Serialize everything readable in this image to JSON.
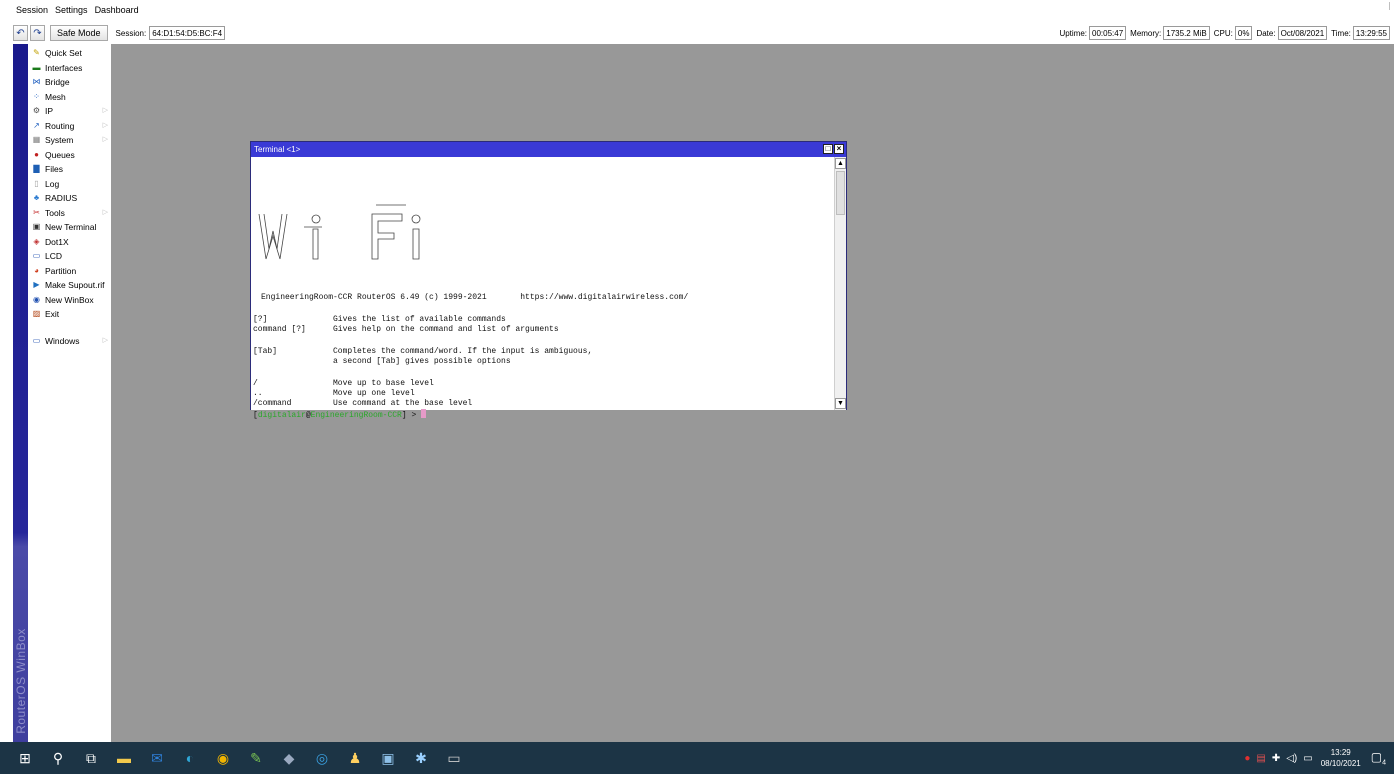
{
  "menubar": {
    "items": [
      "Session",
      "Settings",
      "Dashboard"
    ]
  },
  "toolbar": {
    "undo_icon": "undo-icon",
    "redo_icon": "redo-icon",
    "safe_mode_label": "Safe Mode",
    "session_label": "Session:",
    "session_value": "64:D1:54:D5:BC:F4",
    "status": {
      "uptime_label": "Uptime:",
      "uptime_value": "00:05:47",
      "memory_label": "Memory:",
      "memory_value": "1735.2 MiB",
      "cpu_label": "CPU:",
      "cpu_value": "0%",
      "date_label": "Date:",
      "date_value": "Oct/08/2021",
      "time_label": "Time:",
      "time_value": "13:29:55"
    }
  },
  "rail": {
    "text": "RouterOS WinBox"
  },
  "sidebar": {
    "items": [
      {
        "label": "Quick Set",
        "icon": "wand-icon",
        "color": "#c0a000",
        "submenu": false
      },
      {
        "label": "Interfaces",
        "icon": "interfaces-icon",
        "color": "#1a7a1a",
        "submenu": false
      },
      {
        "label": "Bridge",
        "icon": "bridge-icon",
        "color": "#2060c0",
        "submenu": false
      },
      {
        "label": "Mesh",
        "icon": "mesh-icon",
        "color": "#2060c0",
        "submenu": false
      },
      {
        "label": "IP",
        "icon": "ip-icon",
        "color": "#505050",
        "submenu": true
      },
      {
        "label": "Routing",
        "icon": "routing-icon",
        "color": "#2060c0",
        "submenu": true
      },
      {
        "label": "System",
        "icon": "system-icon",
        "color": "#808080",
        "submenu": true
      },
      {
        "label": "Queues",
        "icon": "queues-icon",
        "color": "#c02020",
        "submenu": false
      },
      {
        "label": "Files",
        "icon": "files-icon",
        "color": "#1e5fb4",
        "submenu": false
      },
      {
        "label": "Log",
        "icon": "log-icon",
        "color": "#a0a0a0",
        "submenu": false
      },
      {
        "label": "RADIUS",
        "icon": "radius-icon",
        "color": "#2a7ad0",
        "submenu": false
      },
      {
        "label": "Tools",
        "icon": "tools-icon",
        "color": "#c02020",
        "submenu": true
      },
      {
        "label": "New Terminal",
        "icon": "terminal-icon",
        "color": "#303030",
        "submenu": false
      },
      {
        "label": "Dot1X",
        "icon": "dot1x-icon",
        "color": "#c03030",
        "submenu": false
      },
      {
        "label": "LCD",
        "icon": "lcd-icon",
        "color": "#2050b0",
        "submenu": false
      },
      {
        "label": "Partition",
        "icon": "partition-icon",
        "color": "#d04020",
        "submenu": false
      },
      {
        "label": "Make Supout.rif",
        "icon": "supout-icon",
        "color": "#2070c0",
        "submenu": false
      },
      {
        "label": "New WinBox",
        "icon": "winbox-icon",
        "color": "#2050b0",
        "submenu": false
      },
      {
        "label": "Exit",
        "icon": "exit-icon",
        "color": "#b04010",
        "submenu": false
      }
    ],
    "windows": {
      "label": "Windows",
      "icon": "windows-list-icon",
      "color": "#2050b0",
      "submenu": true
    }
  },
  "terminal": {
    "title": "Terminal <1>",
    "ascii_logo": "WiFi",
    "banner": "EngineeringRoom-CCR RouterOS 6.49 (c) 1999-2021       https://www.digitalairwireless.com/",
    "help": [
      {
        "cmd": "[?]",
        "desc": "Gives the list of available commands"
      },
      {
        "cmd": "command [?]",
        "desc": "Gives help on the command and list of arguments"
      },
      {
        "cmd": "[Tab]",
        "desc": "Completes the command/word. If the input is ambiguous,"
      },
      {
        "cmd": "",
        "desc": "a second [Tab] gives possible options"
      },
      {
        "cmd": "/",
        "desc": "Move up to base level"
      },
      {
        "cmd": "..",
        "desc": "Move up one level"
      },
      {
        "cmd": "/command",
        "desc": "Use command at the base level"
      }
    ],
    "prompt": {
      "open": "[",
      "user": "digitalair",
      "at": "@",
      "host": "EngineeringRoom-CCR",
      "close": "] > "
    }
  },
  "taskbar": {
    "apps": [
      {
        "name": "start-icon",
        "glyph": "⊞",
        "color": "#ffffff"
      },
      {
        "name": "search-icon",
        "glyph": "⚲",
        "color": "#ffffff"
      },
      {
        "name": "task-view-icon",
        "glyph": "⧉",
        "color": "#ffffff"
      },
      {
        "name": "file-explorer-icon",
        "glyph": "▬",
        "color": "#f2c94c"
      },
      {
        "name": "mail-icon",
        "glyph": "✉",
        "color": "#2f7fd8"
      },
      {
        "name": "edge-icon",
        "glyph": "◐",
        "color": "#2fa8d8"
      },
      {
        "name": "chrome-icon",
        "glyph": "◉",
        "color": "#f0b400"
      },
      {
        "name": "notepad-icon",
        "glyph": "✎",
        "color": "#79c153"
      },
      {
        "name": "app-icon",
        "glyph": "◆",
        "color": "#9aa9c0"
      },
      {
        "name": "network-tool-icon",
        "glyph": "◎",
        "color": "#3aa0e0"
      },
      {
        "name": "users-icon",
        "glyph": "♟",
        "color": "#ffd060"
      },
      {
        "name": "monitor-icon",
        "glyph": "▣",
        "color": "#8ec0e8"
      },
      {
        "name": "puzzle-icon",
        "glyph": "✱",
        "color": "#9ad0ff"
      },
      {
        "name": "cmd-icon",
        "glyph": "▭",
        "color": "#cccccc"
      }
    ],
    "tray_icons": [
      "antivirus-icon",
      "network-alert-icon",
      "shield-tray-icon",
      "volume-icon",
      "display-icon"
    ],
    "time": "13:29",
    "date": "08/10/2021",
    "notification_count": "4"
  }
}
